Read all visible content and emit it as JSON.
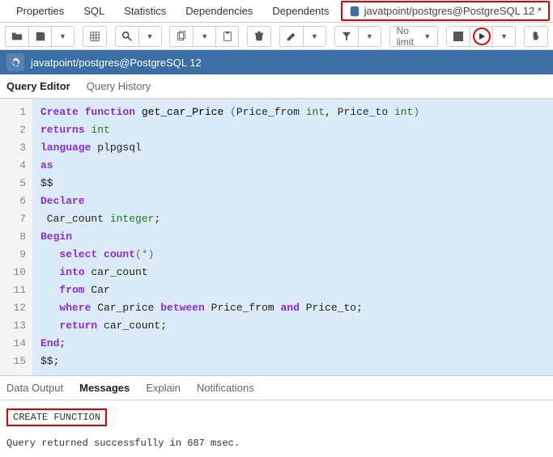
{
  "top_tabs": {
    "properties": "Properties",
    "sql": "SQL",
    "statistics": "Statistics",
    "dependencies": "Dependencies",
    "dependents": "Dependents",
    "connection": "javatpoint/postgres@PostgreSQL 12 *"
  },
  "toolbar": {
    "nolimit": "No limit"
  },
  "conn_bar": {
    "label": "javatpoint/postgres@PostgreSQL 12"
  },
  "editor_tabs": {
    "query_editor": "Query Editor",
    "query_history": "Query History"
  },
  "code": {
    "lines": [
      "1",
      "2",
      "3",
      "4",
      "5",
      "6",
      "7",
      "8",
      "9",
      "10",
      "11",
      "12",
      "13",
      "14",
      "15"
    ],
    "l1_kw1": "Create",
    "l1_kw2": "function",
    "l1_fn": " get_car_Price ",
    "l1_p1": "(",
    "l1_a1": "Price_from ",
    "l1_t1": "int",
    "l1_c": ", ",
    "l1_a2": "Price_to ",
    "l1_t2": "int",
    "l1_p2": ")",
    "l2_kw": "returns",
    "l2_t": " int",
    "l3_kw": "language",
    "l3_v": " plpgsql",
    "l4_kw": "as",
    "l5": "$$",
    "l6_kw": "Declare",
    "l7_v": " Car_count ",
    "l7_t": "integer",
    "l7_s": ";",
    "l8_kw": "Begin",
    "l9_i": "   ",
    "l9_kw1": "select",
    "l9_sp": " ",
    "l9_kw2": "count",
    "l9_p": "(",
    "l9_star": "*",
    "l9_p2": ")",
    "l10_i": "   ",
    "l10_kw": "into",
    "l10_v": " car_count",
    "l11_i": "   ",
    "l11_kw": "from",
    "l11_v": " Car",
    "l12_i": "   ",
    "l12_kw1": "where",
    "l12_v1": " Car_price ",
    "l12_kw2": "between",
    "l12_v2": " Price_from ",
    "l12_kw3": "and",
    "l12_v3": " Price_to;",
    "l13_i": "   ",
    "l13_kw": "return",
    "l13_v": " car_count;",
    "l14_kw": "End",
    "l14_s": ";",
    "l15": "$$;"
  },
  "output_tabs": {
    "data_output": "Data Output",
    "messages": "Messages",
    "explain": "Explain",
    "notifications": "Notifications"
  },
  "messages": {
    "result": "CREATE FUNCTION",
    "status": "Query returned successfully in 687 msec."
  }
}
